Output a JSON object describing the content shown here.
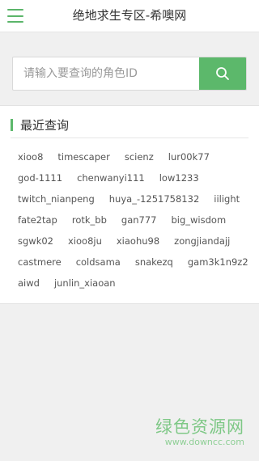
{
  "header": {
    "title": "绝地求生专区-希噢网",
    "menu_icon": "hamburger-menu-icon"
  },
  "search": {
    "placeholder": "请输入要查询的角色ID",
    "value": "",
    "button_icon": "search-icon"
  },
  "recent": {
    "title": "最近查询",
    "rows": [
      [
        "xioo8",
        "timescaper",
        "scienz",
        "lur00k77"
      ],
      [
        "god-1111",
        "chenwanyi111",
        "low1233"
      ],
      [
        "twitch_nianpeng",
        "huya_-1251758132",
        "iilight"
      ],
      [
        "fate2tap",
        "rotk_bb",
        "gan777",
        "big_wisdom"
      ],
      [
        "sgwk02",
        "xioo8ju",
        "xiaohu98",
        "zongjiandajj"
      ],
      [
        "castmere",
        "coldsama",
        "snakezq",
        "gam3k1n9z2"
      ],
      [
        "aiwd",
        "junlin_xiaoan"
      ]
    ]
  },
  "watermark": {
    "name": "绿色资源网",
    "url": "www.downcc.com"
  },
  "colors": {
    "accent": "#5cb86b",
    "background": "#f0f0f0",
    "text": "#333333"
  }
}
